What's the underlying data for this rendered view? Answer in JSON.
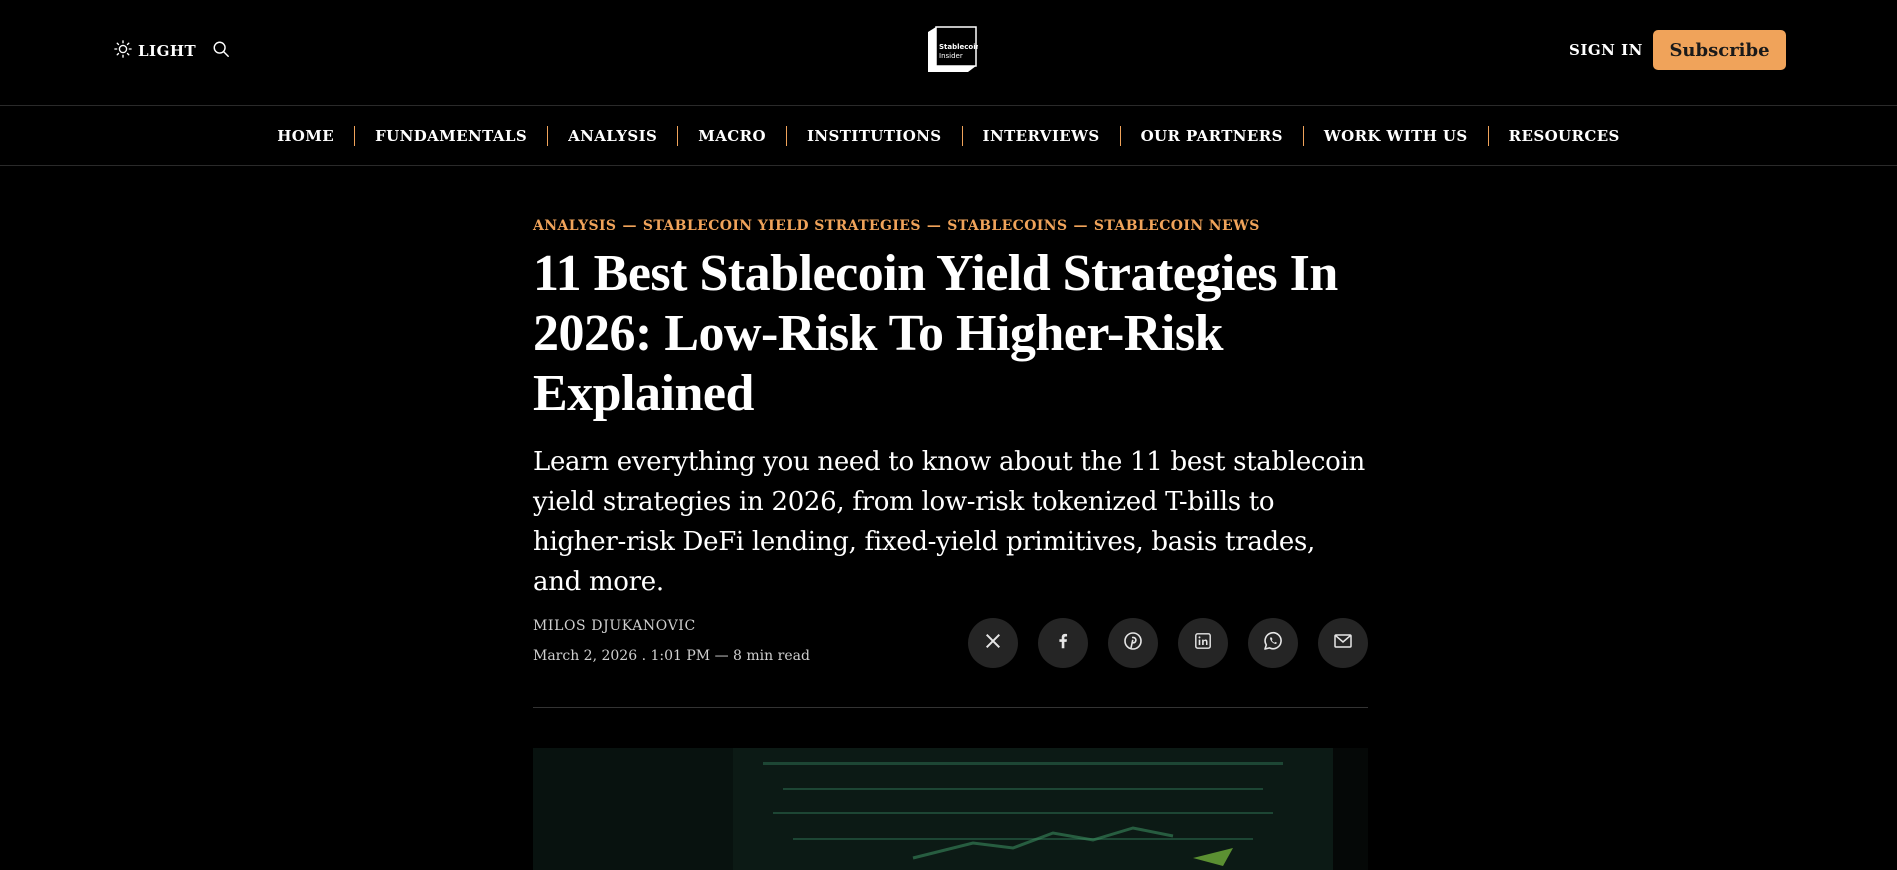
{
  "header": {
    "theme_label": "LIGHT",
    "logo_text": [
      "Stablecoin",
      "Insider"
    ],
    "signin_label": "SIGN IN",
    "subscribe_label": "Subscribe",
    "icons": {
      "theme": "sun-icon",
      "search": "search-icon"
    }
  },
  "nav": {
    "items": [
      {
        "label": "HOME"
      },
      {
        "label": "FUNDAMENTALS"
      },
      {
        "label": "ANALYSIS"
      },
      {
        "label": "MACRO"
      },
      {
        "label": "INSTITUTIONS"
      },
      {
        "label": "INTERVIEWS"
      },
      {
        "label": "OUR PARTNERS"
      },
      {
        "label": "WORK WITH US"
      },
      {
        "label": "RESOURCES"
      }
    ]
  },
  "article": {
    "categories": [
      "ANALYSIS",
      "STABLECOIN YIELD STRATEGIES",
      "STABLECOINS",
      "STABLECOIN NEWS"
    ],
    "title": "11 Best Stablecoin Yield Strategies In 2026: Low-Risk To Higher-Risk Explained",
    "subtitle": "Learn everything you need to know about the 11 best stablecoin yield strategies in 2026, from low-risk tokenized T-bills to higher-risk DeFi lending, fixed-yield primitives, basis trades, and more.",
    "author": "MILOS DJUKANOVIC",
    "date": "March 2, 2026",
    "time": "1:01 PM",
    "read_time": "8 min read",
    "share_icons": [
      "x-icon",
      "facebook-icon",
      "pinterest-icon",
      "linkedin-icon",
      "whatsapp-icon",
      "email-icon"
    ]
  },
  "colors": {
    "background": "#000000",
    "accent": "#f0a35a",
    "share_bg": "#252525",
    "text": "#ffffff",
    "muted": "#cfcfcf"
  }
}
